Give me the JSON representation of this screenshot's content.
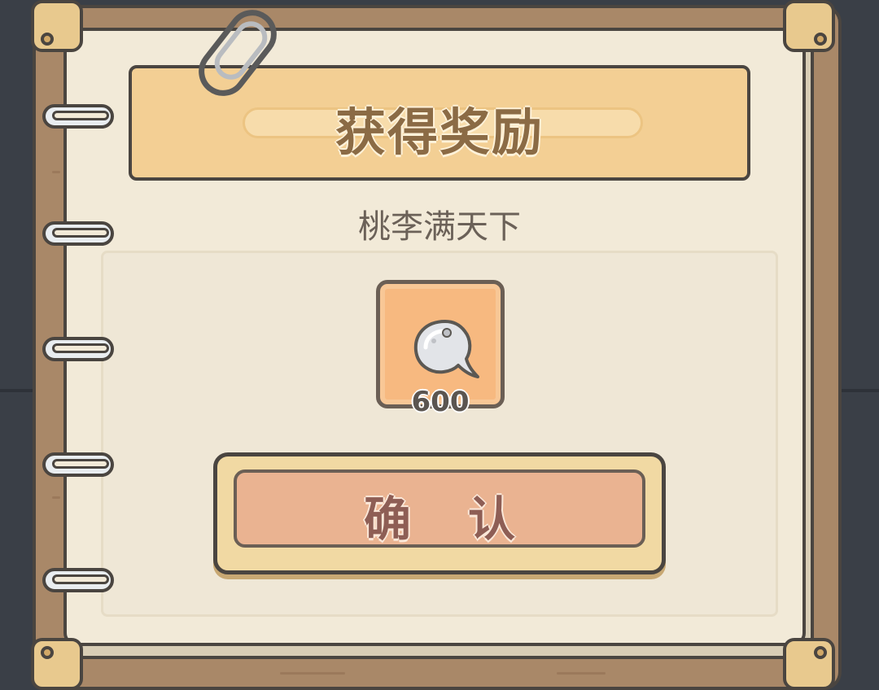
{
  "dialog": {
    "title": "获得奖励",
    "subtitle": "桃李满天下"
  },
  "reward": {
    "icon": "ghost-bubble-icon",
    "count": "600"
  },
  "actions": {
    "confirm_label": "确认"
  },
  "colors": {
    "background": "#3a3f47",
    "frame_wood": "#a98868",
    "paper": "#f2ead8",
    "banner": "#f3cf94",
    "reward_tile": "#f7b980",
    "button_face": "#eab391",
    "outline": "#4a4540"
  }
}
